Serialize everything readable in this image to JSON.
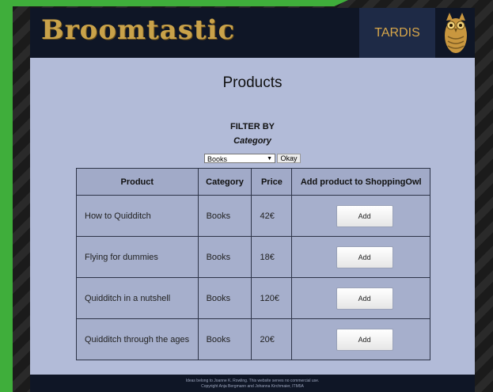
{
  "header": {
    "logo_text": "Broomtastic",
    "nav_item": "TARDIS",
    "owl_icon": "owl-icon"
  },
  "page": {
    "title": "Products"
  },
  "filter": {
    "heading": "FILTER BY",
    "subheading": "Category",
    "selected_option": "Books",
    "button_label": "Okay"
  },
  "table": {
    "columns": [
      "Product",
      "Category",
      "Price",
      "Add product to ShoppingOwl"
    ],
    "rows": [
      {
        "product": "How to Quidditch",
        "category": "Books",
        "price": "42€",
        "action": "Add"
      },
      {
        "product": "Flying for dummies",
        "category": "Books",
        "price": "18€",
        "action": "Add"
      },
      {
        "product": "Quidditch in a nutshell",
        "category": "Books",
        "price": "120€",
        "action": "Add"
      },
      {
        "product": "Quidditch through the ages",
        "category": "Books",
        "price": "20€",
        "action": "Add"
      }
    ]
  },
  "footer": {
    "line1": "Ideas belong to Joanne K. Rowling. This website serves no commercial use.",
    "line2": "Copyright Anja Bergmann and Johanna Kirchmaier, ITM5A"
  },
  "colors": {
    "accent_gold": "#c9a24a",
    "header_bg": "#0f1626",
    "content_bg": "#b2bbd8"
  }
}
